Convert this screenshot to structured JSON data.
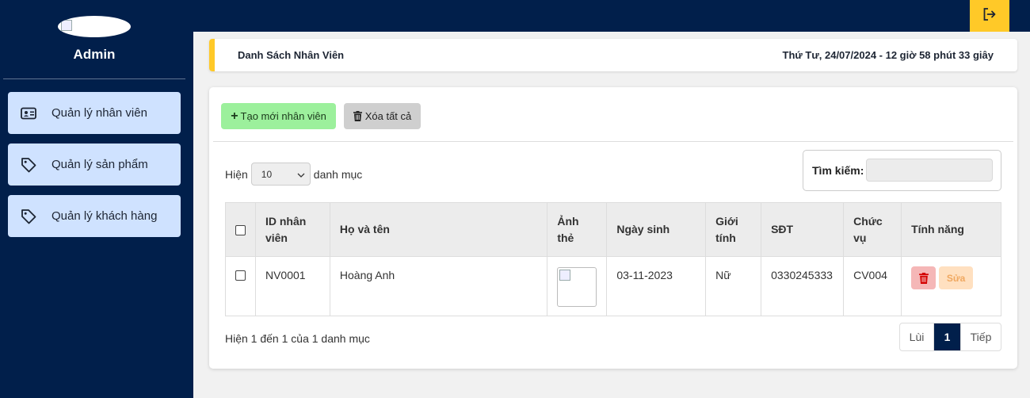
{
  "sidebar": {
    "user_name": "Admin",
    "items": [
      {
        "label": "Quản lý nhân viên",
        "icon": "id-card-icon"
      },
      {
        "label": "Quản lý sản phẩm",
        "icon": "tag-icon"
      },
      {
        "label": "Quản lý khách hàng",
        "icon": "tag-icon"
      }
    ]
  },
  "topbar": {
    "logout_icon": "logout-icon"
  },
  "header": {
    "title": "Danh Sách Nhân Viên",
    "datetime": "Thứ Tư, 24/07/2024 - 12 giờ 58 phút 33 giây"
  },
  "toolbar": {
    "create_label": "Tạo mới nhân viên",
    "delete_all_label": "Xóa tất cả"
  },
  "list_controls": {
    "show_prefix": "Hiện",
    "page_size": "10",
    "show_suffix": "danh mục",
    "search_label": "Tìm kiếm:",
    "search_value": ""
  },
  "table": {
    "headers": [
      "ID nhân viên",
      "Họ và tên",
      "Ảnh thẻ",
      "Ngày sinh",
      "Giới tính",
      "SĐT",
      "Chức vụ",
      "Tính năng"
    ],
    "rows": [
      {
        "id": "NV0001",
        "name": "Hoàng Anh",
        "birth": "03-11-2023",
        "gender": "Nữ",
        "phone": "0330245333",
        "position": "CV004",
        "edit_label": "Sửa"
      }
    ]
  },
  "footer": {
    "info": "Hiện 1 đến 1 của 1 danh mục",
    "prev": "Lùi",
    "current_page": "1",
    "next": "Tiếp"
  },
  "colors": {
    "navy": "#011f4b",
    "accent": "#ffc928",
    "nav_item": "#cfe2ff",
    "create": "#9cf09c"
  }
}
